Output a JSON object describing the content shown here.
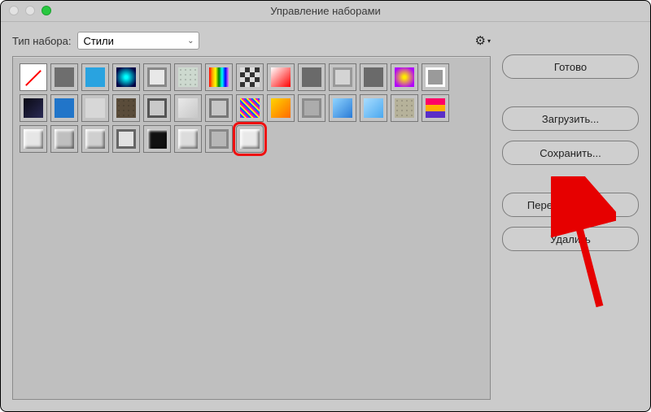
{
  "window": {
    "title": "Управление наборами"
  },
  "toprow": {
    "label": "Тип набора:",
    "selected": "Стили"
  },
  "buttons": {
    "done": "Готово",
    "load": "Загрузить...",
    "save": "Сохранить...",
    "rename": "Переименовать...",
    "delete": "Удалить"
  },
  "swatches": {
    "cols": 14,
    "selected_index": 35,
    "items": [
      {
        "type": "none"
      },
      {
        "type": "solid",
        "bg": "#6e6e6e"
      },
      {
        "type": "solid",
        "bg": "#29a3e0"
      },
      {
        "type": "radial",
        "from": "#0ff",
        "to": "#004"
      },
      {
        "type": "frame",
        "bg": "#e8e8e8",
        "bd": "#888"
      },
      {
        "type": "pattern",
        "bg": "#cdd9cf"
      },
      {
        "type": "rainbow"
      },
      {
        "type": "checker"
      },
      {
        "type": "grad",
        "from": "#fff",
        "to": "#f00"
      },
      {
        "type": "solid",
        "bg": "#6a6a6a"
      },
      {
        "type": "frame",
        "bg": "#d4d4d4",
        "bd": "#999"
      },
      {
        "type": "solid",
        "bg": "#6a6a6a"
      },
      {
        "type": "radial",
        "from": "#ffea00",
        "to": "#b000ff"
      },
      {
        "type": "frame",
        "bg": "#9a9a9a",
        "bd": "#fff"
      },
      {
        "type": "grad",
        "from": "#0a0a14",
        "to": "#2a2a55"
      },
      {
        "type": "solid",
        "bg": "#2175c9"
      },
      {
        "type": "solid",
        "bg": "#d7d7d7"
      },
      {
        "type": "pattern",
        "bg": "#5a4c3a"
      },
      {
        "type": "frame",
        "bg": "#c9c9c9",
        "bd": "#555"
      },
      {
        "type": "grad",
        "from": "#e9e9e9",
        "to": "#c8c8c8"
      },
      {
        "type": "frame",
        "bg": "#c6c6c6",
        "bd": "#777"
      },
      {
        "type": "noise"
      },
      {
        "type": "grad",
        "from": "#ffd400",
        "to": "#ff6a00"
      },
      {
        "type": "frame",
        "bg": "#acacac",
        "bd": "#8c8c8c"
      },
      {
        "type": "grad",
        "from": "#8fd4ff",
        "to": "#2a7bd6"
      },
      {
        "type": "grad",
        "from": "#a8dcff",
        "to": "#4aa8ef"
      },
      {
        "type": "pattern",
        "bg": "#b6b29a"
      },
      {
        "type": "stripes"
      },
      {
        "type": "bevel",
        "bg": "#e6e6e6"
      },
      {
        "type": "bevel",
        "bg": "#bfbfbf"
      },
      {
        "type": "bevel",
        "bg": "#cfcfcf"
      },
      {
        "type": "frame",
        "bg": "#e2e2e2",
        "bd": "#666"
      },
      {
        "type": "bevel",
        "bg": "#111"
      },
      {
        "type": "bevel",
        "bg": "#dcdcdc"
      },
      {
        "type": "frame",
        "bg": "#b7b7b7",
        "bd": "#888"
      },
      {
        "type": "bevel",
        "bg": "#e9e9e9"
      }
    ]
  }
}
